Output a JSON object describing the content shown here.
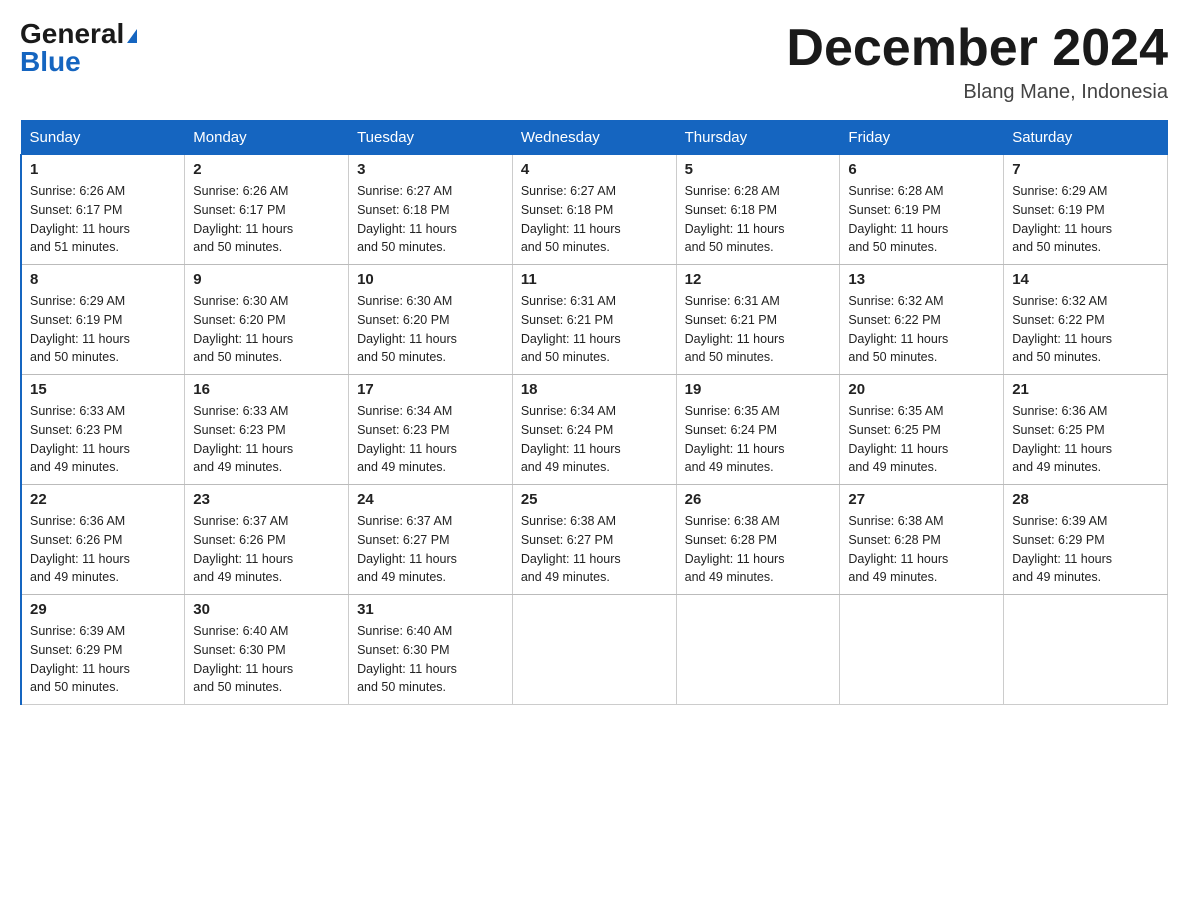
{
  "header": {
    "logo_general": "General",
    "logo_blue": "Blue",
    "month_title": "December 2024",
    "location": "Blang Mane, Indonesia"
  },
  "days_of_week": [
    "Sunday",
    "Monday",
    "Tuesday",
    "Wednesday",
    "Thursday",
    "Friday",
    "Saturday"
  ],
  "weeks": [
    [
      {
        "day": "1",
        "sunrise": "6:26 AM",
        "sunset": "6:17 PM",
        "daylight": "11 hours and 51 minutes."
      },
      {
        "day": "2",
        "sunrise": "6:26 AM",
        "sunset": "6:17 PM",
        "daylight": "11 hours and 50 minutes."
      },
      {
        "day": "3",
        "sunrise": "6:27 AM",
        "sunset": "6:18 PM",
        "daylight": "11 hours and 50 minutes."
      },
      {
        "day": "4",
        "sunrise": "6:27 AM",
        "sunset": "6:18 PM",
        "daylight": "11 hours and 50 minutes."
      },
      {
        "day": "5",
        "sunrise": "6:28 AM",
        "sunset": "6:18 PM",
        "daylight": "11 hours and 50 minutes."
      },
      {
        "day": "6",
        "sunrise": "6:28 AM",
        "sunset": "6:19 PM",
        "daylight": "11 hours and 50 minutes."
      },
      {
        "day": "7",
        "sunrise": "6:29 AM",
        "sunset": "6:19 PM",
        "daylight": "11 hours and 50 minutes."
      }
    ],
    [
      {
        "day": "8",
        "sunrise": "6:29 AM",
        "sunset": "6:19 PM",
        "daylight": "11 hours and 50 minutes."
      },
      {
        "day": "9",
        "sunrise": "6:30 AM",
        "sunset": "6:20 PM",
        "daylight": "11 hours and 50 minutes."
      },
      {
        "day": "10",
        "sunrise": "6:30 AM",
        "sunset": "6:20 PM",
        "daylight": "11 hours and 50 minutes."
      },
      {
        "day": "11",
        "sunrise": "6:31 AM",
        "sunset": "6:21 PM",
        "daylight": "11 hours and 50 minutes."
      },
      {
        "day": "12",
        "sunrise": "6:31 AM",
        "sunset": "6:21 PM",
        "daylight": "11 hours and 50 minutes."
      },
      {
        "day": "13",
        "sunrise": "6:32 AM",
        "sunset": "6:22 PM",
        "daylight": "11 hours and 50 minutes."
      },
      {
        "day": "14",
        "sunrise": "6:32 AM",
        "sunset": "6:22 PM",
        "daylight": "11 hours and 50 minutes."
      }
    ],
    [
      {
        "day": "15",
        "sunrise": "6:33 AM",
        "sunset": "6:23 PM",
        "daylight": "11 hours and 49 minutes."
      },
      {
        "day": "16",
        "sunrise": "6:33 AM",
        "sunset": "6:23 PM",
        "daylight": "11 hours and 49 minutes."
      },
      {
        "day": "17",
        "sunrise": "6:34 AM",
        "sunset": "6:23 PM",
        "daylight": "11 hours and 49 minutes."
      },
      {
        "day": "18",
        "sunrise": "6:34 AM",
        "sunset": "6:24 PM",
        "daylight": "11 hours and 49 minutes."
      },
      {
        "day": "19",
        "sunrise": "6:35 AM",
        "sunset": "6:24 PM",
        "daylight": "11 hours and 49 minutes."
      },
      {
        "day": "20",
        "sunrise": "6:35 AM",
        "sunset": "6:25 PM",
        "daylight": "11 hours and 49 minutes."
      },
      {
        "day": "21",
        "sunrise": "6:36 AM",
        "sunset": "6:25 PM",
        "daylight": "11 hours and 49 minutes."
      }
    ],
    [
      {
        "day": "22",
        "sunrise": "6:36 AM",
        "sunset": "6:26 PM",
        "daylight": "11 hours and 49 minutes."
      },
      {
        "day": "23",
        "sunrise": "6:37 AM",
        "sunset": "6:26 PM",
        "daylight": "11 hours and 49 minutes."
      },
      {
        "day": "24",
        "sunrise": "6:37 AM",
        "sunset": "6:27 PM",
        "daylight": "11 hours and 49 minutes."
      },
      {
        "day": "25",
        "sunrise": "6:38 AM",
        "sunset": "6:27 PM",
        "daylight": "11 hours and 49 minutes."
      },
      {
        "day": "26",
        "sunrise": "6:38 AM",
        "sunset": "6:28 PM",
        "daylight": "11 hours and 49 minutes."
      },
      {
        "day": "27",
        "sunrise": "6:38 AM",
        "sunset": "6:28 PM",
        "daylight": "11 hours and 49 minutes."
      },
      {
        "day": "28",
        "sunrise": "6:39 AM",
        "sunset": "6:29 PM",
        "daylight": "11 hours and 49 minutes."
      }
    ],
    [
      {
        "day": "29",
        "sunrise": "6:39 AM",
        "sunset": "6:29 PM",
        "daylight": "11 hours and 50 minutes."
      },
      {
        "day": "30",
        "sunrise": "6:40 AM",
        "sunset": "6:30 PM",
        "daylight": "11 hours and 50 minutes."
      },
      {
        "day": "31",
        "sunrise": "6:40 AM",
        "sunset": "6:30 PM",
        "daylight": "11 hours and 50 minutes."
      },
      null,
      null,
      null,
      null
    ]
  ],
  "labels": {
    "sunrise": "Sunrise:",
    "sunset": "Sunset:",
    "daylight": "Daylight:"
  }
}
